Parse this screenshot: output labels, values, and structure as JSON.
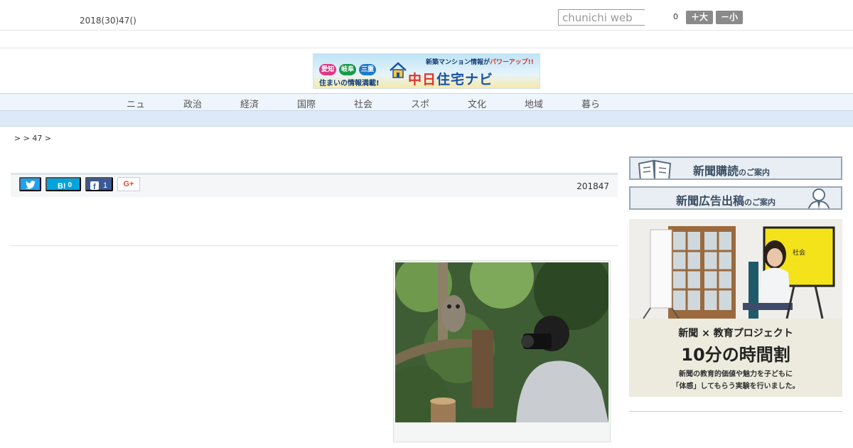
{
  "header": {
    "date": "2018(30)47()",
    "search_placeholder": "chunichi web",
    "count": "0",
    "size_up_label": "＋大",
    "size_down_label": "－小"
  },
  "banner": {
    "badges": [
      "愛知",
      "岐阜",
      "三重"
    ],
    "tagline": "住まいの情報満載!",
    "top_text": "新築マンション情報が",
    "power_text": "パワーアップ!!",
    "logo_red": "中日",
    "logo_blue": "住宅ナビ"
  },
  "nav": {
    "items": [
      "ニュ",
      "政治",
      "経済",
      "国際",
      "社会",
      "スポ",
      "文化",
      "地域",
      "暮ら"
    ]
  },
  "breadcrumb": ">  > 47 >",
  "article": {
    "share": {
      "hatena_label": "B!",
      "hatena_count": "0",
      "facebook_count": "1",
      "gplus_label": "G+"
    },
    "date": "201847",
    "photo_caption": ""
  },
  "sidebar": {
    "subscribe_main": "新聞購読",
    "subscribe_small": "のご案内",
    "ad_main": "新聞広告出稿",
    "ad_small": "のご案内",
    "promo": {
      "screen_text": "社会",
      "line1": "新聞 × 教育プロジェクト",
      "line2": "10分の時間割",
      "line3": "新聞の教育的価値や魅力を子どもに",
      "line4": "「体感」してもらう実験を行いました。"
    }
  },
  "colors": {
    "nav_bg": "#eef5fc",
    "subnav_bg": "#dde9f7",
    "twitter": "#1da1f2",
    "hatena": "#00a4de",
    "facebook": "#3b5998",
    "side_button_bg": "#e8eef3"
  }
}
